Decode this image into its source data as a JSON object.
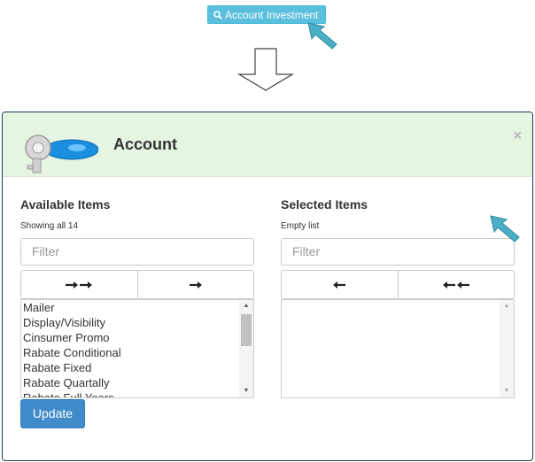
{
  "trigger": {
    "label": "Account Investment",
    "icon": "search-icon"
  },
  "modal": {
    "title": "Account",
    "close_label": "×",
    "available": {
      "title": "Available Items",
      "info": "Showing all 14",
      "filter_placeholder": "Filter",
      "move_all_icon": "double-right-arrow-icon",
      "move_selected_icon": "right-arrow-icon",
      "items": [
        "Mailer",
        "Display/Visibility",
        "Cinsumer Promo",
        "Rabate Conditional",
        "Rabate Fixed",
        "Rabate Quartally",
        "Rabate Full Years"
      ]
    },
    "selected": {
      "title": "Selected Items",
      "info": "Empty list",
      "filter_placeholder": "Filter",
      "remove_selected_icon": "left-arrow-icon",
      "remove_all_icon": "double-left-arrow-icon",
      "items": []
    },
    "update_label": "Update"
  },
  "colors": {
    "accent": "#5bc0de",
    "primary": "#428bca",
    "header_bg": "#e6f4e2"
  }
}
